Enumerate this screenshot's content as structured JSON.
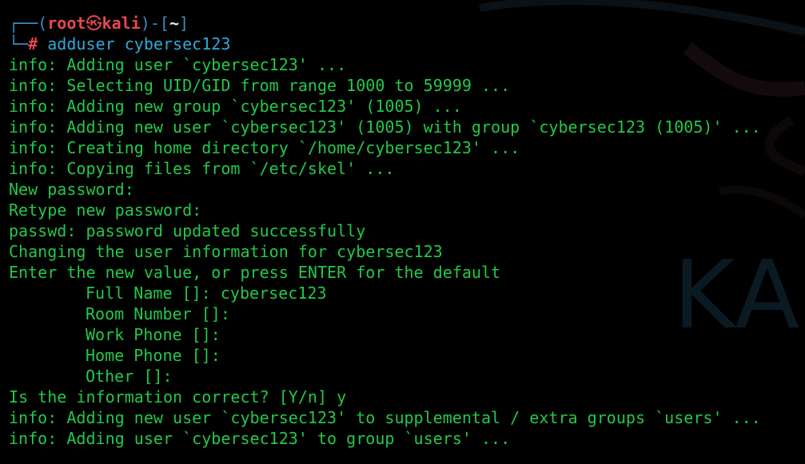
{
  "prompt": {
    "user": "root",
    "host": "kali",
    "cwd": "~",
    "symbol": "#",
    "command": "adduser cybersec123"
  },
  "watermark": "KALI",
  "output_lines": [
    "info: Adding user `cybersec123' ...",
    "info: Selecting UID/GID from range 1000 to 59999 ...",
    "info: Adding new group `cybersec123' (1005) ...",
    "info: Adding new user `cybersec123' (1005) with group `cybersec123 (1005)' ...",
    "info: Creating home directory `/home/cybersec123' ...",
    "info: Copying files from `/etc/skel' ...",
    "New password:",
    "Retype new password:",
    "passwd: password updated successfully",
    "Changing the user information for cybersec123",
    "Enter the new value, or press ENTER for the default"
  ],
  "user_info_fields": [
    "Full Name []: cybersec123",
    "Room Number []:",
    "Work Phone []:",
    "Home Phone []:",
    "Other []:"
  ],
  "final_lines": [
    "Is the information correct? [Y/n] y",
    "info: Adding new user `cybersec123' to supplemental / extra groups `users' ...",
    "info: Adding user `cybersec123' to group `users' ..."
  ],
  "colors": {
    "background": "#000000",
    "output_text": "#23c84a",
    "prompt_box": "#3b8ec6",
    "prompt_user": "#e5484f",
    "command": "#2eaadc"
  }
}
